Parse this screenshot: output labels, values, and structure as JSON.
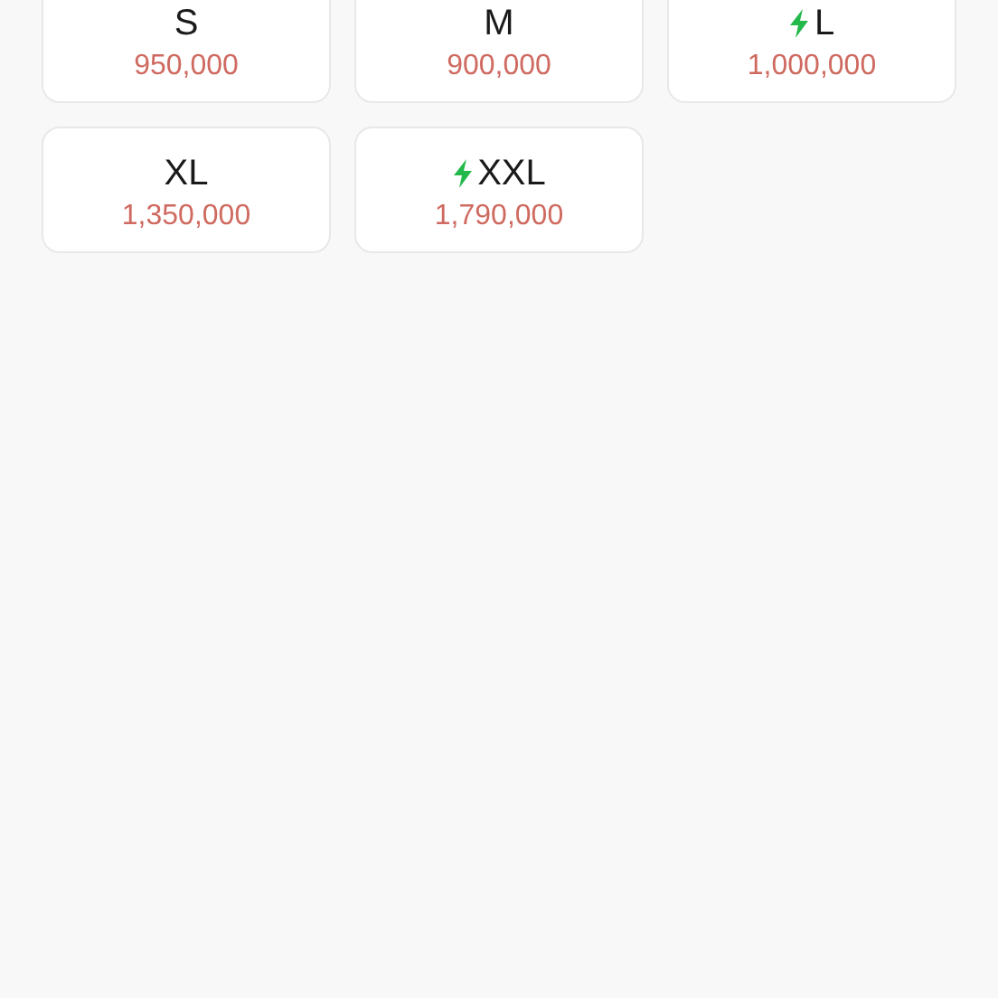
{
  "sizes": [
    {
      "label": "S",
      "price": "950,000",
      "express": false
    },
    {
      "label": "M",
      "price": "900,000",
      "express": false
    },
    {
      "label": "L",
      "price": "1,000,000",
      "express": true
    },
    {
      "label": "XL",
      "price": "1,350,000",
      "express": false
    },
    {
      "label": "XXL",
      "price": "1,790,000",
      "express": true
    }
  ]
}
